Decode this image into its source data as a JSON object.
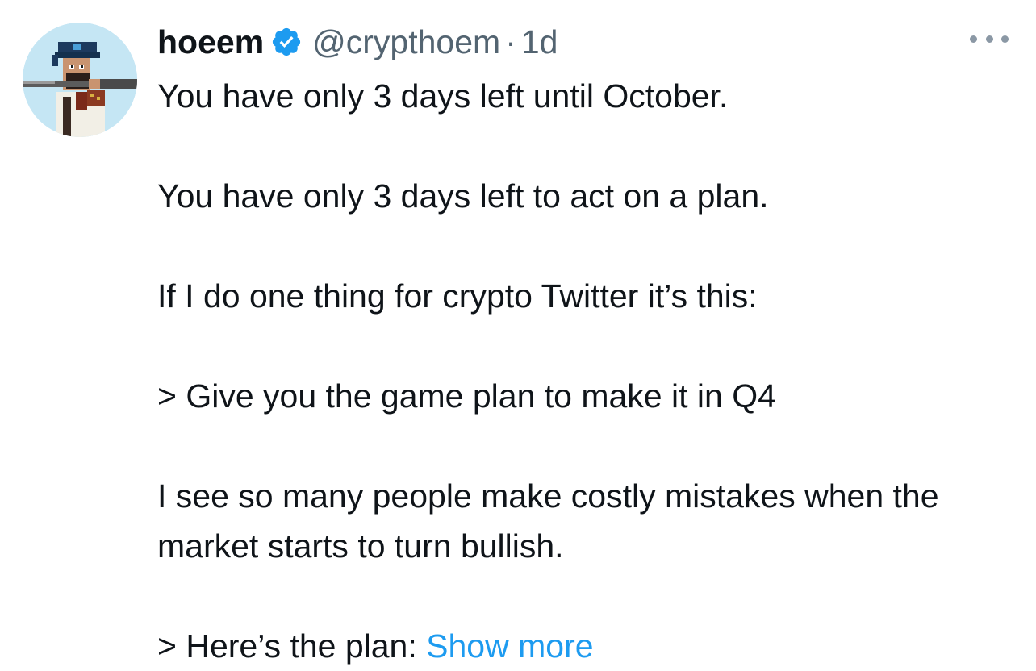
{
  "tweet": {
    "author": {
      "display_name": "hoeem",
      "verified_icon": "verified-badge-icon",
      "handle": "@crypthoem",
      "separator": "·",
      "time": "1d"
    },
    "more_icon": "more-horizontal-icon",
    "paragraphs": [
      "You have only 3 days left until October.",
      "You have only 3 days left to act on a plan.",
      "If I do one thing for crypto Twitter it’s this:",
      "> Give you the game plan to make it in Q4",
      "I see so many people make costly mistakes when the market starts to turn bullish."
    ],
    "last_paragraph": "> Here’s the plan: ",
    "show_more": "Show more"
  },
  "colors": {
    "text": "#0f1419",
    "secondary": "#536471",
    "link": "#1d9bf0",
    "verified": "#1d9bf0"
  }
}
